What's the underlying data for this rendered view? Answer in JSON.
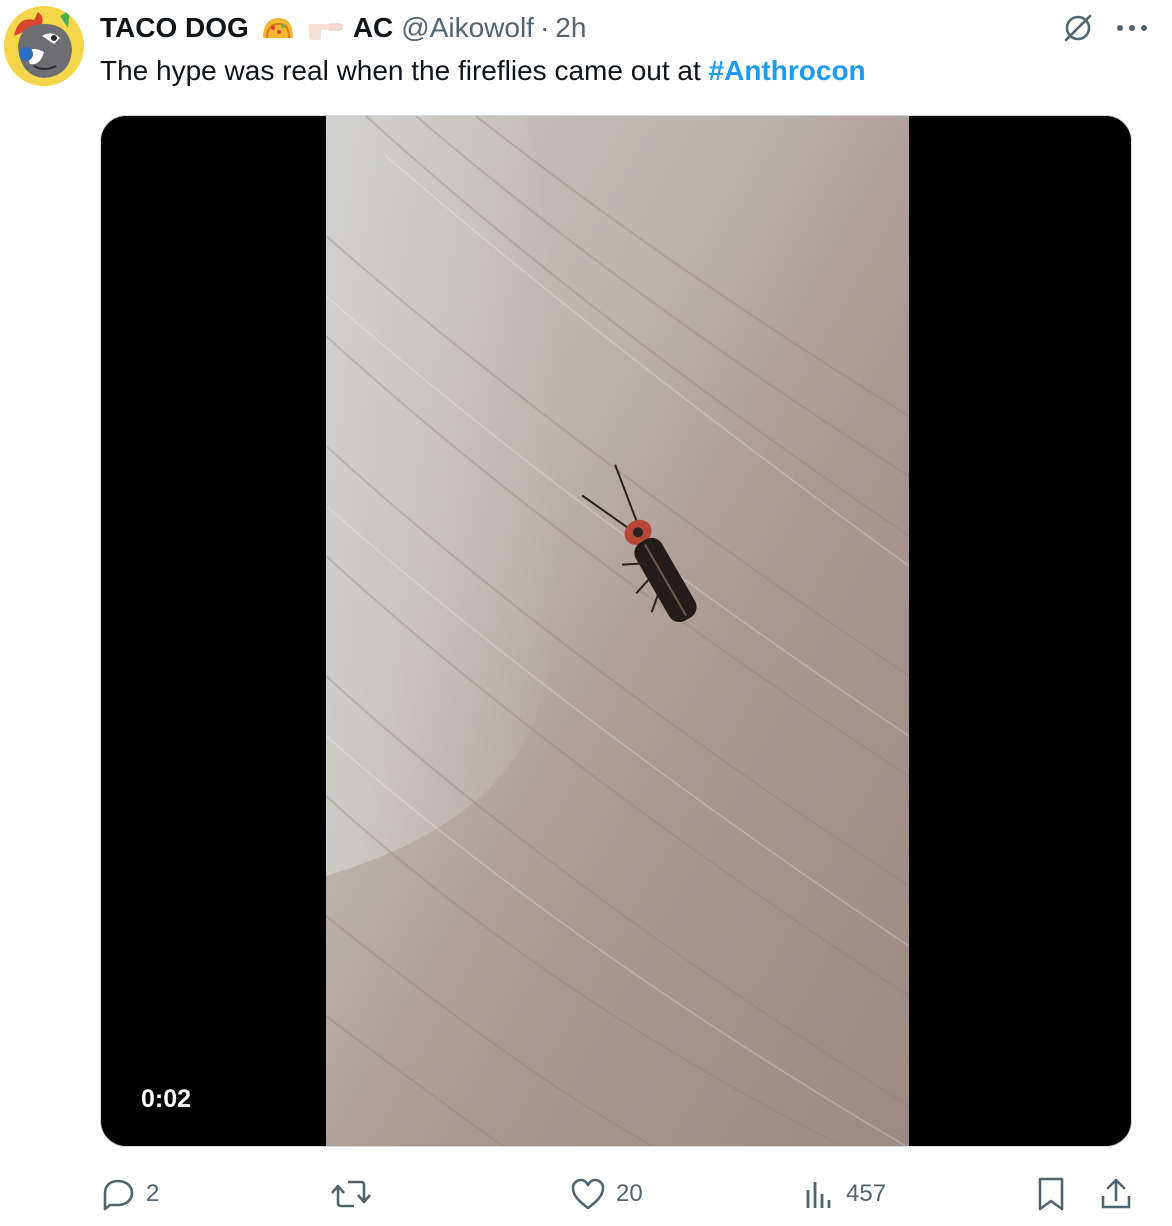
{
  "author": {
    "display_name": "TACO DOG",
    "name_suffix": "AC",
    "handle": "@Aikowolf",
    "separator": "·",
    "time": "2h"
  },
  "tweet": {
    "text": "The hype was real when the fireflies came out at ",
    "hashtag": "#Anthrocon"
  },
  "media": {
    "duration": "0:02"
  },
  "actions": {
    "replies": "2",
    "reposts": "",
    "likes": "20",
    "views": "457"
  },
  "icons": {
    "grok": "slashed-circle-icon",
    "more": "more-icon",
    "reply": "reply-icon",
    "repost": "repost-icon",
    "like": "heart-icon",
    "views": "analytics-icon",
    "bookmark": "bookmark-icon",
    "share": "share-icon"
  },
  "colors": {
    "link": "#1d9bf0",
    "secondary_text": "#536471",
    "primary_text": "#0f1419"
  }
}
